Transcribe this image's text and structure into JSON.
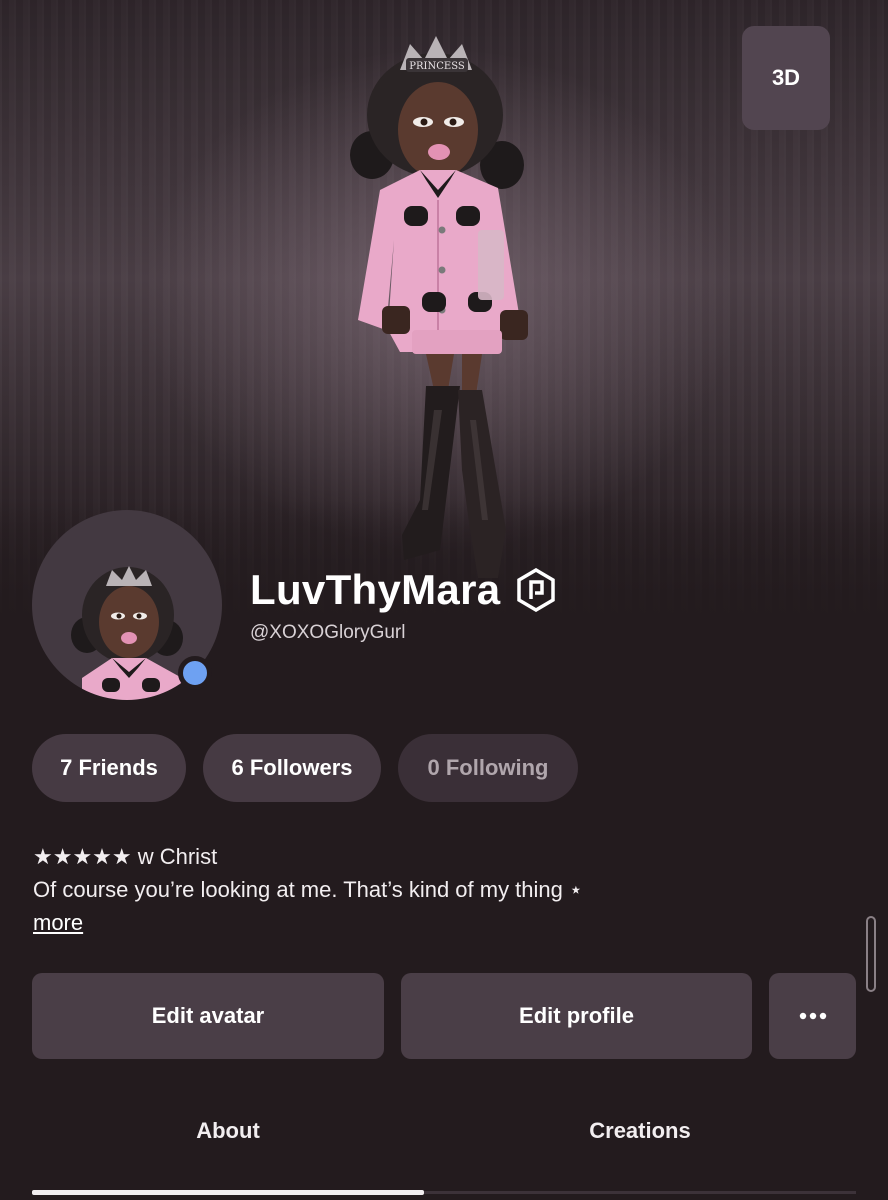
{
  "hero": {
    "view_3d_label": "3D",
    "crown_text": "PRINCESS"
  },
  "profile": {
    "display_name": "LuvThyMara",
    "username": "@XOXOGloryGurl",
    "online_status_color": "#6ea1f2"
  },
  "stats": {
    "friends": "7 Friends",
    "followers": "6 Followers",
    "following": "0 Following"
  },
  "bio": {
    "line1": "★★★★★ w Christ",
    "line2": "Of course you’re looking at me. That’s kind of my thing ⋆",
    "more": "more"
  },
  "actions": {
    "edit_avatar": "Edit avatar",
    "edit_profile": "Edit profile",
    "more_options_icon": "ellipsis-icon"
  },
  "tabs": [
    {
      "label": "About",
      "active": true
    },
    {
      "label": "Creations",
      "active": false
    }
  ],
  "colors": {
    "background": "#231b1e",
    "button": "#4a3e47",
    "pill": "#463a43",
    "outfit_pink": "#e9a9c9"
  }
}
